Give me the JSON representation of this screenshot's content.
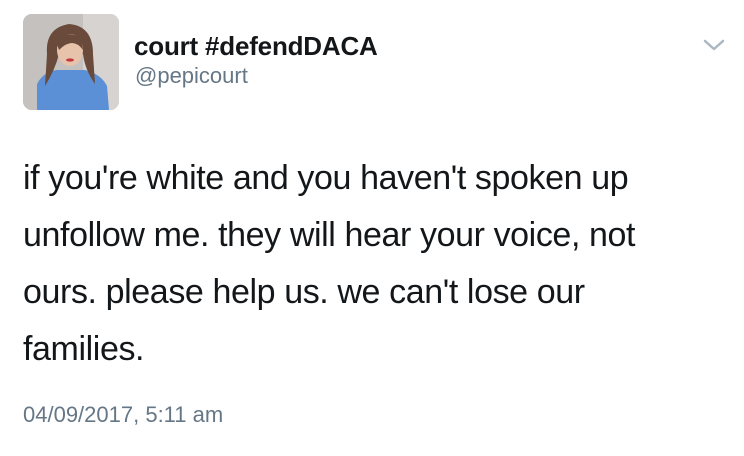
{
  "tweet": {
    "author": {
      "display_name": "court #defendDACA",
      "handle": "@pepicourt",
      "avatar_icon": "profile-photo"
    },
    "menu_icon": "chevron-down-icon",
    "text_lines": [
      "if you're white and you haven't spoken up",
      "unfollow me. they will hear your voice, not",
      "ours. please help us. we can't lose our",
      "families."
    ],
    "timestamp": "04/09/2017, 5:11 am"
  },
  "colors": {
    "text_primary": "#14171a",
    "text_secondary": "#657786",
    "chevron": "#aab8c2",
    "background": "#ffffff"
  }
}
